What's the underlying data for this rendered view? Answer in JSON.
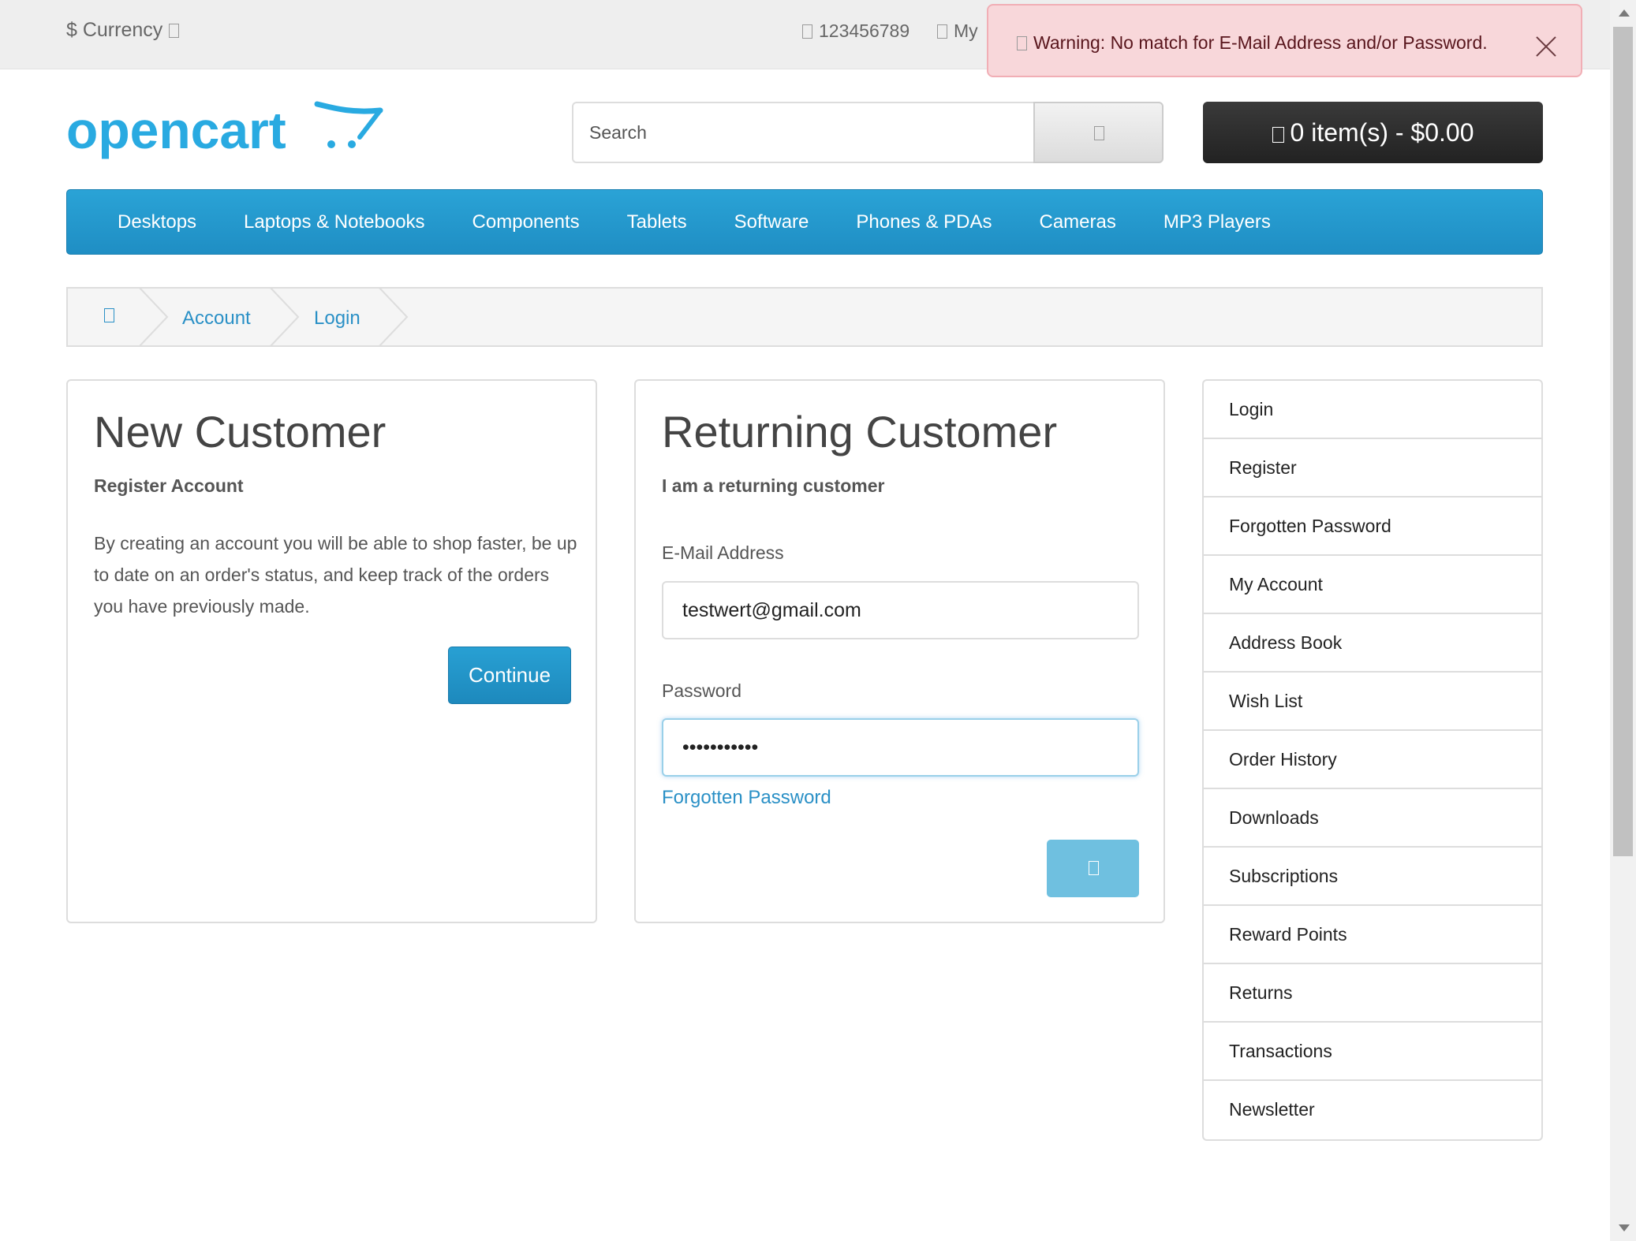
{
  "topbar": {
    "currency_label": "$ Currency",
    "phone": "123456789",
    "my_account": "My"
  },
  "alert": {
    "message": "Warning: No match for E-Mail Address and/or Password."
  },
  "header": {
    "logo_text": "opencart",
    "search_placeholder": "Search",
    "cart_label": "0 item(s) - $0.00"
  },
  "menu": {
    "items": [
      "Desktops",
      "Laptops & Notebooks",
      "Components",
      "Tablets",
      "Software",
      "Phones & PDAs",
      "Cameras",
      "MP3 Players"
    ]
  },
  "breadcrumb": {
    "items": [
      "Account",
      "Login"
    ]
  },
  "new_customer": {
    "title": "New Customer",
    "subtitle": "Register Account",
    "description": "By creating an account you will be able to shop faster, be up to date on an order's status, and keep track of the orders you have previously made.",
    "continue_label": "Continue"
  },
  "returning_customer": {
    "title": "Returning Customer",
    "subtitle": "I am a returning customer",
    "email_label": "E-Mail Address",
    "email_value": "testwert@gmail.com",
    "password_label": "Password",
    "password_value": "•••••••••••",
    "forgot_label": "Forgotten Password"
  },
  "sidebar": {
    "items": [
      "Login",
      "Register",
      "Forgotten Password",
      "My Account",
      "Address Book",
      "Wish List",
      "Order History",
      "Downloads",
      "Subscriptions",
      "Reward Points",
      "Returns",
      "Transactions",
      "Newsletter"
    ]
  },
  "colors": {
    "brand_blue": "#2aa3d6",
    "link_blue": "#2a90c6",
    "alert_bg": "#f8d7da",
    "cart_bg": "#222222"
  }
}
